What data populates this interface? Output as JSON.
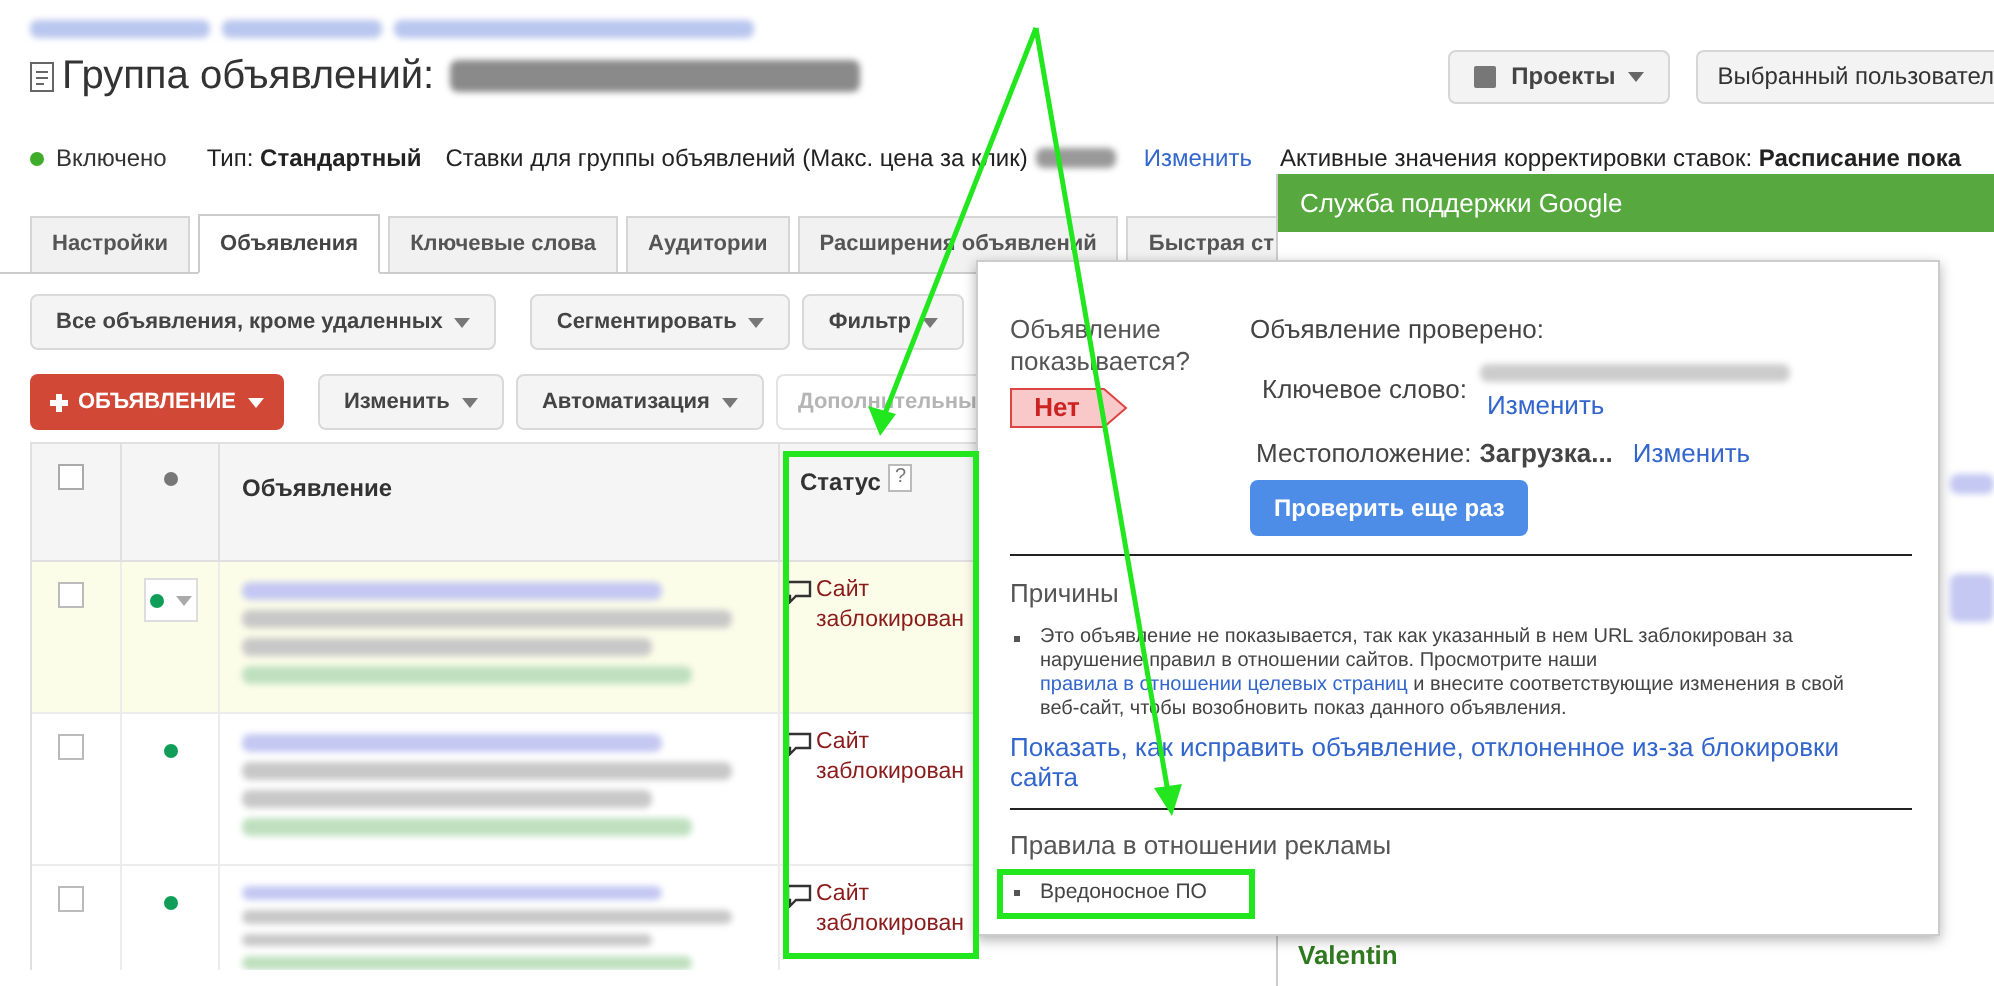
{
  "page_title": "Группа объявлений:",
  "header_buttons": [
    {
      "label": "Проекты",
      "kind": "menu"
    },
    {
      "label": "Выбранный пользовател",
      "kind": "plain"
    }
  ],
  "status_line": {
    "state": "Включено",
    "type_label": "Тип:",
    "type_value": "Стандартный",
    "bids_label": "Ставки для группы объявлений (Макс. цена за клик)",
    "change_link": "Изменить",
    "adjustments_label": "Активные значения корректировки ставок:",
    "adjustments_value": "Расписание пока"
  },
  "tabs": [
    {
      "label": "Настройки",
      "selected": false
    },
    {
      "label": "Объявления",
      "selected": true
    },
    {
      "label": "Ключевые слова",
      "selected": false
    },
    {
      "label": "Аудитории",
      "selected": false
    },
    {
      "label": "Расширения объявлений",
      "selected": false
    },
    {
      "label": "Быстрая ст",
      "selected": false
    }
  ],
  "toolbar_rows": [
    [
      {
        "label": "Все объявления, кроме удаленных",
        "kind": "dropdown"
      },
      {
        "label": "Сегментировать",
        "kind": "dropdown"
      },
      {
        "label": "Фильтр",
        "kind": "dropdown"
      }
    ],
    [
      {
        "label": "ОБЪЯВЛЕНИЕ",
        "kind": "primary"
      },
      {
        "label": "Изменить",
        "kind": "dropdown"
      },
      {
        "label": "Автоматизация",
        "kind": "dropdown"
      },
      {
        "label": "Дополнительны",
        "kind": "disabled"
      }
    ]
  ],
  "table": {
    "all_checked": false,
    "columns": [
      {
        "label": "Объявление"
      },
      {
        "label": "Статус",
        "help": "?"
      }
    ],
    "rows": [
      {
        "highlighted": true,
        "checked": false,
        "status": "Сайт заблокирован"
      },
      {
        "highlighted": false,
        "checked": false,
        "status": "Сайт заблокирован"
      },
      {
        "highlighted": false,
        "checked": false,
        "status": "Сайт заблокирован"
      }
    ]
  },
  "support_panel": {
    "title": "Служба поддержки Google",
    "user": "Valentin"
  },
  "popup": {
    "question": "Объявление показывается?",
    "answer": "Нет",
    "checked_title": "Объявление проверено:",
    "keyword_label": "Ключевое слово:",
    "keyword_change": "Изменить",
    "location_label": "Местоположение:",
    "location_value": "Загрузка...",
    "location_change": "Изменить",
    "recheck_button": "Проверить еще раз",
    "reasons_title": "Причины",
    "reasons": [
      {
        "before": "Это объявление не показывается, так как указанный в нем URL заблокирован за нарушение правил в отношении сайтов. Просмотрите наши ",
        "link": "правила в отношении целевых страниц",
        "after": " и внесите соответствующие изменения в свой веб-сайт, чтобы возобновить показ данного объявления."
      }
    ],
    "fix_link": "Показать, как исправить объявление, отклоненное из-за блокировки сайта",
    "policies_title": "Правила в отношении рекламы",
    "policies": [
      "Вредоносное ПО"
    ]
  }
}
